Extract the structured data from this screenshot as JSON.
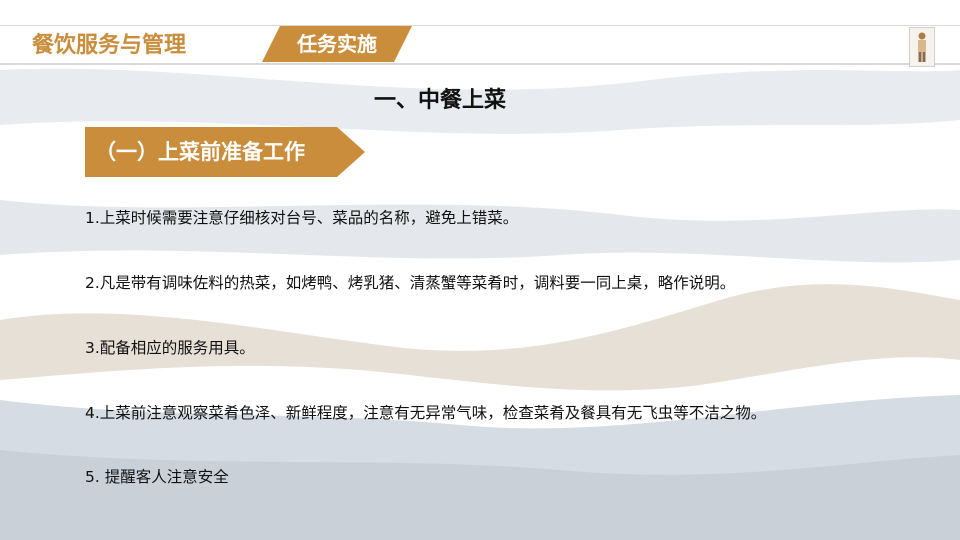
{
  "header": {
    "course_title": "餐饮服务与管理",
    "task_tab": "任务实施",
    "logo_icon": "chef-figure-icon"
  },
  "colors": {
    "accent": "#c98d3c",
    "text": "#111111",
    "background_wave": "#dfe3e8"
  },
  "section": {
    "title": "一、中餐上菜",
    "subsection_title": "（一）上菜前准备工作"
  },
  "items": [
    "1.上菜时候需要注意仔细核对台号、菜品的名称，避免上错菜。",
    "2.凡是带有调味佐料的热菜，如烤鸭、烤乳猪、清蒸蟹等菜肴时，调料要一同上桌，略作说明。",
    "3.配备相应的服务用具。",
    "4.上菜前注意观察菜肴色泽、新鲜程度，注意有无异常气味，检查菜肴及餐具有无飞虫等不洁之物。",
    "5.  提醒客人注意安全"
  ]
}
